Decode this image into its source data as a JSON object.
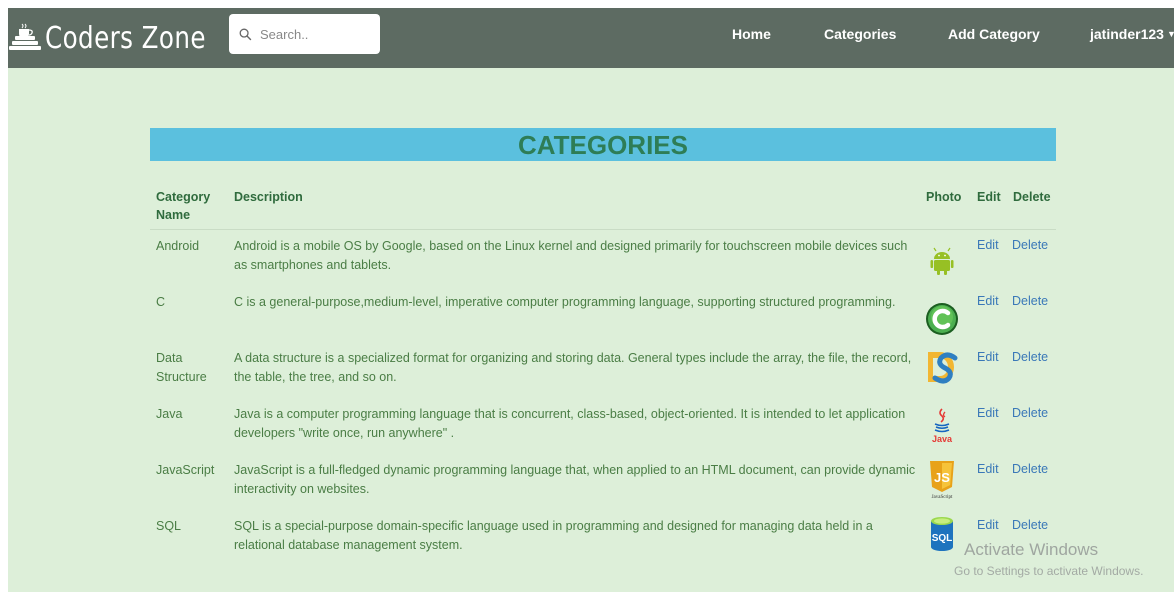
{
  "navbar": {
    "brand": "Coders Zone",
    "search_placeholder": "Search..",
    "links": [
      "Home",
      "Categories",
      "Add Category"
    ],
    "user": "jatinder123"
  },
  "page": {
    "title": "CATEGORIES"
  },
  "table": {
    "headers": {
      "name": "Category Name",
      "description": "Description",
      "photo": "Photo",
      "edit": "Edit",
      "delete": "Delete"
    },
    "rows": [
      {
        "name": "Android",
        "description": "Android is a mobile OS by Google, based on the Linux kernel and designed primarily for touchscreen mobile devices such as smartphones and tablets.",
        "photo_icon": "android-icon",
        "edit": "Edit",
        "delete": "Delete"
      },
      {
        "name": "C",
        "description": "C is a general-purpose,medium-level, imperative computer programming language, supporting structured programming.",
        "photo_icon": "c-language-icon",
        "edit": "Edit",
        "delete": "Delete"
      },
      {
        "name": "Data Structure",
        "description": "A data structure is a specialized format for organizing and storing data. General types include the array, the file, the record, the table, the tree, and so on.",
        "photo_icon": "data-structure-icon",
        "edit": "Edit",
        "delete": "Delete"
      },
      {
        "name": "Java",
        "description": "Java is a computer programming language that is concurrent, class-based, object-oriented. It is intended to let application developers \"write once, run anywhere\" .",
        "photo_icon": "java-icon",
        "edit": "Edit",
        "delete": "Delete"
      },
      {
        "name": "JavaScript",
        "description": "JavaScript is a full-fledged dynamic programming language that, when applied to an HTML document, can provide dynamic interactivity on websites.",
        "photo_icon": "javascript-icon",
        "edit": "Edit",
        "delete": "Delete"
      },
      {
        "name": "SQL",
        "description": "SQL is a special-purpose domain-specific language used in programming and designed for managing data held in a relational database management system.",
        "photo_icon": "sql-icon",
        "edit": "Edit",
        "delete": "Delete"
      }
    ]
  },
  "photo_labels": {
    "java": "Java",
    "javascript": "JavaScript",
    "sql": "SQL"
  },
  "watermark": {
    "line1": "Activate Windows",
    "line2": "Go to Settings to activate Windows."
  },
  "colors": {
    "navbar": "#5d6b62",
    "background": "#ddefd9",
    "heading_bar": "#5bc0de",
    "heading_text": "#2e7d56",
    "link": "#3a78b8"
  }
}
